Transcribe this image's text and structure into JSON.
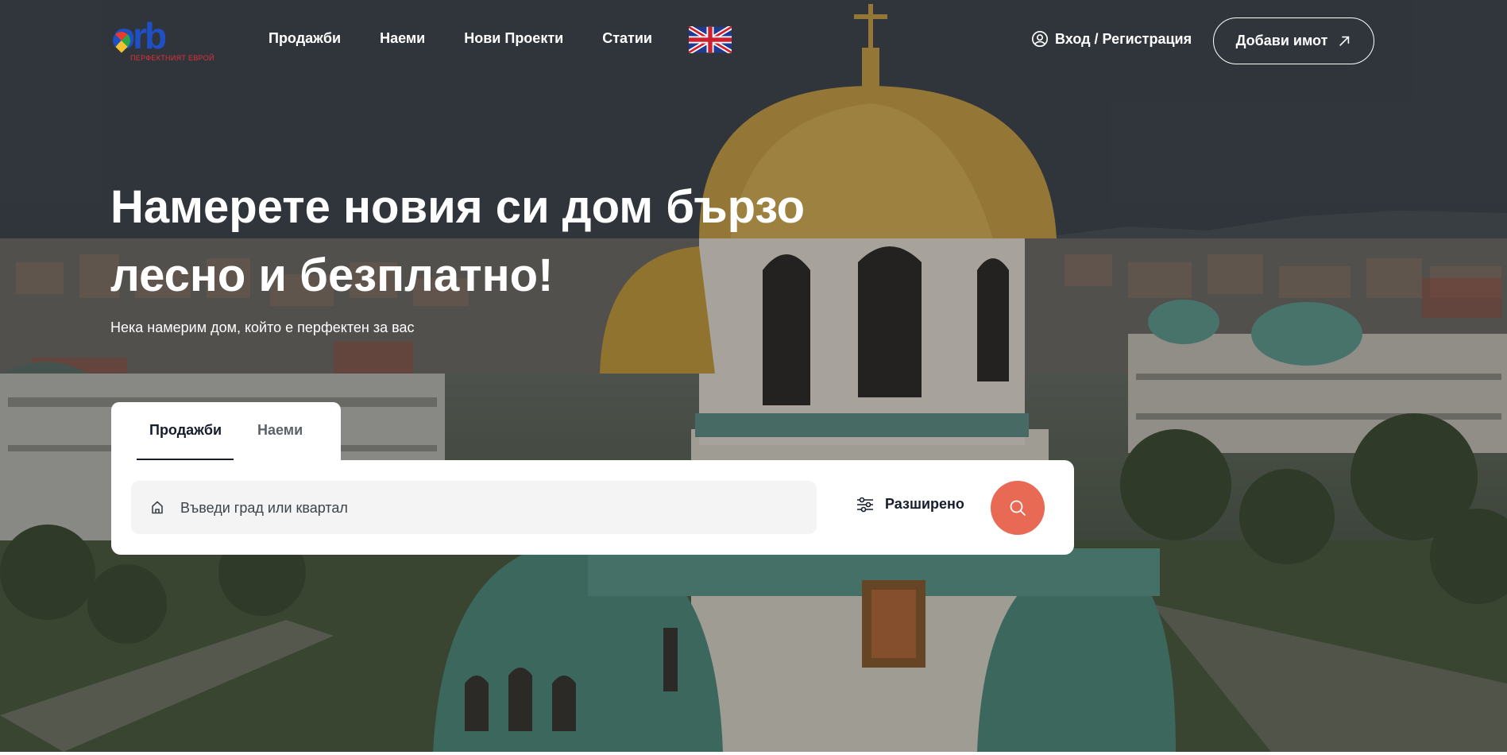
{
  "header": {
    "logo": {
      "main": "orb",
      "tagline": "ПЕРФЕКТНИЯТ ЕВРОЙ"
    },
    "nav": [
      {
        "label": "Продажби"
      },
      {
        "label": "Наеми"
      },
      {
        "label": "Нови Проекти"
      },
      {
        "label": "Статии"
      }
    ],
    "language_flag": "uk-flag-icon",
    "login_label": "Вход / Регистрация",
    "add_property_label": "Добави имот"
  },
  "hero": {
    "headline_line1": "Намерете новия си дом бързо",
    "headline_line2": "лесно и безплатно!",
    "subheadline": "Нека намерим дом, който е перфектен за вас"
  },
  "search": {
    "tabs": [
      {
        "label": "Продажби",
        "active": true
      },
      {
        "label": "Наеми",
        "active": false
      }
    ],
    "placeholder": "Въведи град или квартал",
    "advanced_label": "Разширено",
    "button_color": "#e86a55"
  },
  "colors": {
    "accent": "#e86a55",
    "text_dark": "#161e2d",
    "logo_blue": "#1f4fc4",
    "logo_red": "#e0313a"
  }
}
